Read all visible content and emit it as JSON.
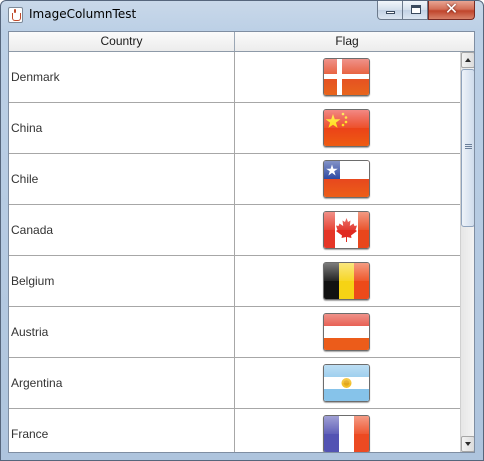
{
  "window": {
    "title": "ImageColumnTest",
    "minimize_icon": "minimize-icon",
    "maximize_icon": "maximize-icon",
    "close_icon": "close-icon",
    "close_glyph": "✕"
  },
  "table": {
    "columns": [
      "Country",
      "Flag"
    ],
    "rows": [
      {
        "country": "Denmark",
        "flag_icon": "denmark-flag-icon"
      },
      {
        "country": "China",
        "flag_icon": "china-flag-icon"
      },
      {
        "country": "Chile",
        "flag_icon": "chile-flag-icon"
      },
      {
        "country": "Canada",
        "flag_icon": "canada-flag-icon"
      },
      {
        "country": "Belgium",
        "flag_icon": "belgium-flag-icon"
      },
      {
        "country": "Austria",
        "flag_icon": "austria-flag-icon"
      },
      {
        "country": "Argentina",
        "flag_icon": "argentina-flag-icon"
      },
      {
        "country": "France",
        "flag_icon": "france-flag-icon"
      }
    ]
  },
  "scrollbar": {
    "up_icon": "scroll-up-arrow-icon",
    "down_icon": "scroll-down-arrow-icon"
  },
  "colors": {
    "titlebar": "#bcd0e6",
    "close_button": "#c0452c",
    "grid_line": "#a7a7a7",
    "scroll_thumb": "#cfdcec"
  }
}
